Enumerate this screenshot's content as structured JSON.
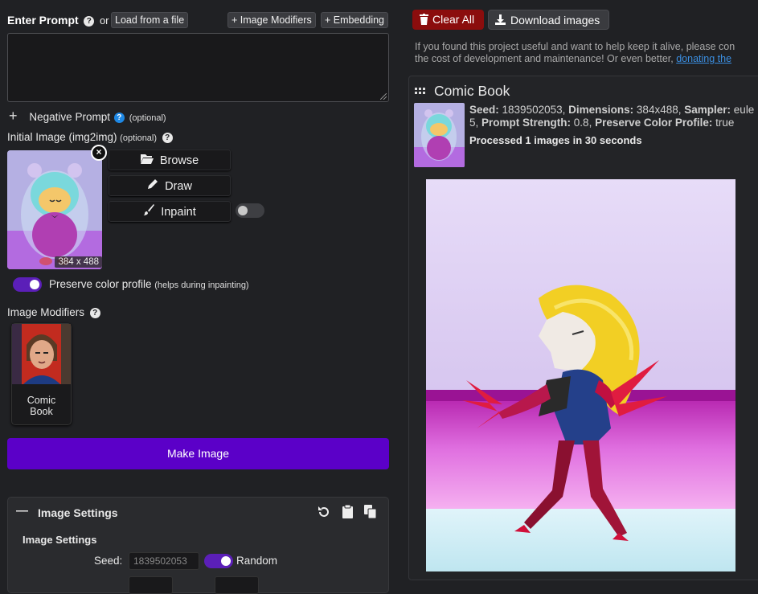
{
  "prompt": {
    "label": "Enter Prompt",
    "or_text": "or",
    "load_file": "Load from a file",
    "image_modifiers_btn": "+ Image Modifiers",
    "embedding_btn": "+ Embedding",
    "value": ""
  },
  "negative": {
    "plus": "+",
    "label": "Negative Prompt",
    "optional": "(optional)"
  },
  "init_image": {
    "label": "Initial Image (img2img)",
    "optional": "(optional)",
    "dimensions": "384 x 488",
    "browse": "Browse",
    "draw": "Draw",
    "inpaint": "Inpaint",
    "inpaint_toggle": false
  },
  "preserve": {
    "label": "Preserve color profile",
    "hint": "(helps during inpainting)",
    "enabled": true
  },
  "modifiers": {
    "label": "Image Modifiers",
    "cards": [
      {
        "line1": "Comic",
        "line2": "Book"
      }
    ]
  },
  "make_image": "Make Image",
  "settings": {
    "collapse": "—",
    "title": "Image Settings",
    "subtitle": "Image Settings",
    "seed_label": "Seed:",
    "seed_value": "1839502053",
    "random_label": "Random",
    "random_enabled": true
  },
  "toolbar": {
    "clear_all": "Clear All",
    "download": "Download images"
  },
  "notice": {
    "line1": "If you found this project useful and want to help keep it alive, please con",
    "line2": "the cost of development and maintenance! Or even better,",
    "link": "donating the"
  },
  "result": {
    "title": "Comic Book",
    "seed_label": "Seed:",
    "seed_value": "1839502053,",
    "dim_label": "Dimensions:",
    "dim_value": "384x488,",
    "sampler_label": "Sampler:",
    "sampler_value": "eule",
    "line2_start": "5,",
    "strength_label": "Prompt Strength:",
    "strength_value": "0.8,",
    "preserve_label": "Preserve Color Profile:",
    "preserve_value": "true",
    "processed": "Processed 1 images in 30 seconds"
  },
  "icons": {
    "help": "?",
    "close": "×",
    "trash": "trash-icon",
    "download": "download-icon",
    "grid": "grid-icon",
    "folder": "folder-open-icon",
    "pencil": "pencil-icon",
    "brush": "brush-icon",
    "reset": "reset-icon",
    "clipboard": "clipboard-icon",
    "copy": "copy-icon"
  },
  "colors": {
    "accent_purple": "#5b00c8",
    "clear_red": "#8b0d0d",
    "link_blue": "#3b8ee0"
  }
}
